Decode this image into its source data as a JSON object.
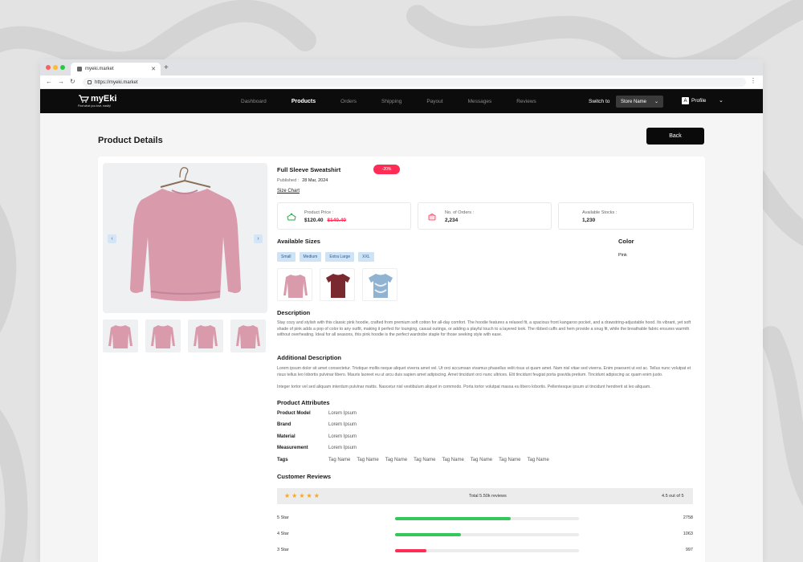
{
  "browser": {
    "tab_title": "myeki.market",
    "url": "https://myeki.market"
  },
  "nav": {
    "logo": "myEki",
    "tagline": "Find what you love, easily!",
    "menu": [
      "Dashboard",
      "Products",
      "Orders",
      "Shipping",
      "Payout",
      "Messages",
      "Reviews"
    ],
    "active_menu": "Products",
    "switch_label": "Switch to",
    "store_select": "Store Name",
    "profile_initial": "A",
    "profile_label": "Profile"
  },
  "page": {
    "title": "Product Details",
    "back_label": "Back"
  },
  "product": {
    "name": "Full Sleeve Sweatshirt",
    "discount": "-20%",
    "published_label": "Published :",
    "published_date": "28 Mar, 2024",
    "size_chart": "Size Chart",
    "stats": [
      {
        "label": "Product Price :",
        "value": "$120.40",
        "old_value": "$140.40",
        "icon": "shirt-icon"
      },
      {
        "label": "No. of Orders :",
        "value": "2,234",
        "icon": "orders-icon"
      },
      {
        "label": "Available Stocks :",
        "value": "1,230",
        "icon": ""
      }
    ],
    "sizes_title": "Available Sizes",
    "sizes": [
      "Small",
      "Medium",
      "Extra Large",
      "XXL"
    ],
    "color_title": "Color",
    "color_value": "Pink",
    "description_title": "Description",
    "description": "Stay cozy and stylish with this classic pink hoodie, crafted from premium soft cotton for all-day comfort. The hoodie features a relaxed fit, a spacious front kangaroo pocket, and a drawstring-adjustable hood. Its vibrant, yet soft shade of pink adds a pop of color to any outfit, making it perfect for lounging, casual outings, or adding a playful touch to a layered look. The ribbed cuffs and hem provide a snug fit, while the breathable fabric ensures warmth without overheating. Ideal for all seasons, this pink hoodie is the perfect wardrobe staple for those seeking style with ease.",
    "additional_title": "Additional Description",
    "additional": "Lorem ipsum dolor sit amet consectetur. Tristique mollis neque aliquet viverra amet vel. Ut orci accumsan vivamus phasellus velit risus ut quam amet. Nam nisl vitae sed viverra. Enim praesent ut est ac. Tellus nunc volutpat et risus tellus leo lobortis pulvinar libero. Mauris laoreet eu ut arcu duis sapien amet adipiscing. Amet tincidunt orci nunc ultrices. Elit tincidunt feugiat porta gravida pretium. Tincidunt adipiscing ac quam enim justo.",
    "additional_2": "Integer tortor vel sed aliquam interdum pulvinar mattis. Nascetur nisl vestibulum aliquet in commodo. Porta tortor volutpat massa eu libero lobortis. Pellentesque ipsum ut tincidunt hendrerit at leo aliquam.",
    "attributes_title": "Product Attributes",
    "attributes": [
      {
        "label": "Product Model",
        "value": "Lorem Ipsum"
      },
      {
        "label": "Brand",
        "value": "Lorem Ipsum"
      },
      {
        "label": "Material",
        "value": "Lorem Ipsum"
      },
      {
        "label": "Measurement",
        "value": "Lorem Ipsum"
      }
    ],
    "tags_label": "Tags",
    "tags": [
      "Tag Name",
      "Tag Name",
      "Tag Name",
      "Tag Name",
      "Tag Name",
      "Tag Name",
      "Tag Name",
      "Tag Name"
    ]
  },
  "reviews": {
    "title": "Customer Reviews",
    "stars": 5,
    "total": "Total 5.50k reviews",
    "average": "4.5 out of 5",
    "rows": [
      {
        "label": "5 Star",
        "count": "2758",
        "fraction": 0.63,
        "color": "#34c759"
      },
      {
        "label": "4 Star",
        "count": "1063",
        "fraction": 0.36,
        "color": "#34c759"
      },
      {
        "label": "3 Star",
        "count": "997",
        "fraction": 0.17,
        "color": "#ff2d55"
      }
    ]
  },
  "colors": {
    "accent_red": "#ff2d55",
    "accent_green": "#34c759",
    "chip_blue": "#cfe3f7",
    "garment_pink": "#d99aab"
  }
}
